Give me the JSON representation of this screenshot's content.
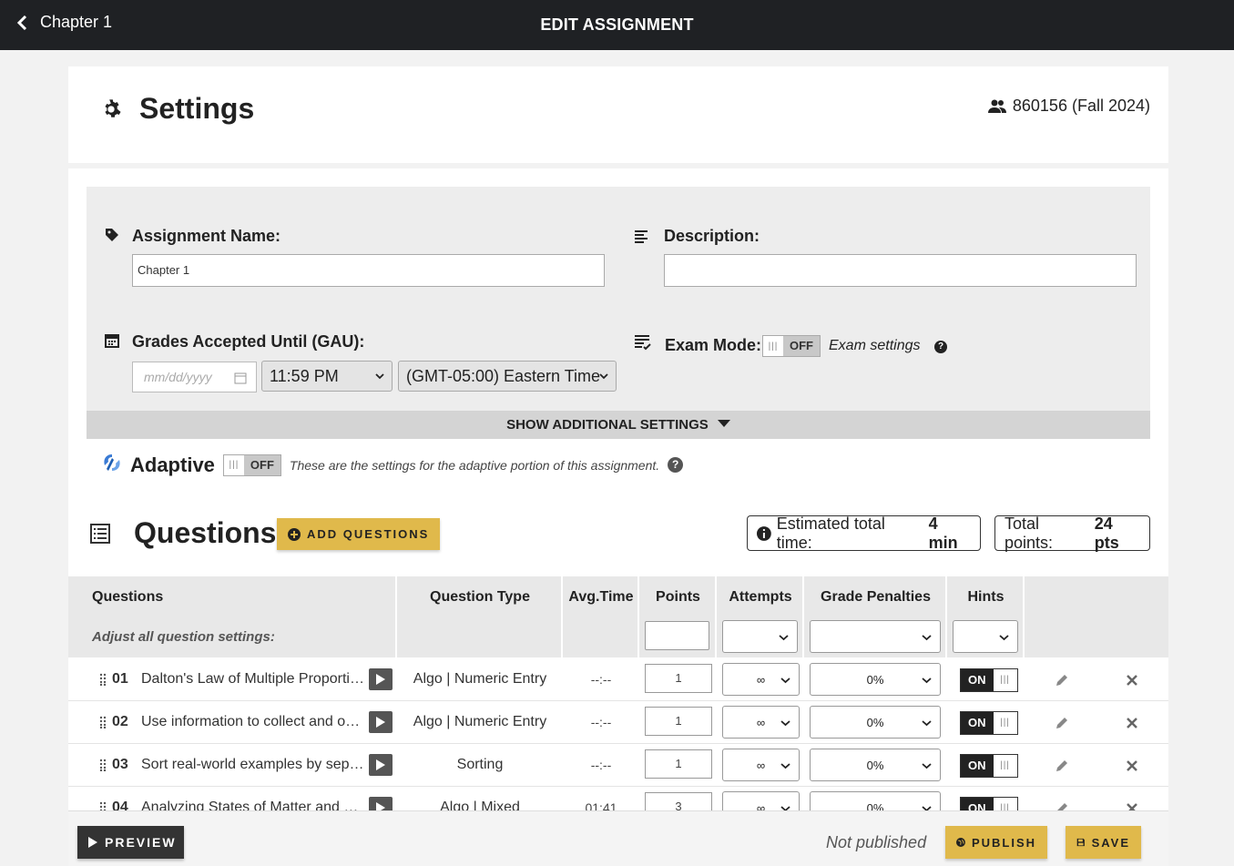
{
  "topbar": {
    "back_label": "Chapter 1",
    "title": "EDIT ASSIGNMENT"
  },
  "header": {
    "title": "Settings",
    "course": "860156 (Fall 2024)"
  },
  "form": {
    "assignment_name_label": "Assignment Name:",
    "assignment_name_value": "Chapter 1",
    "description_label": "Description:",
    "description_value": "",
    "gau_label": "Grades Accepted Until (GAU):",
    "date_placeholder": "mm/dd/yyyy",
    "time_value": "11:59 PM",
    "timezone_value": "(GMT-05:00) Eastern Time",
    "exam_mode_label": "Exam Mode:",
    "exam_mode_state": "OFF",
    "exam_settings_link": "Exam settings",
    "show_additional": "SHOW ADDITIONAL SETTINGS"
  },
  "adaptive": {
    "label": "Adaptive",
    "state": "OFF",
    "description": "These are the settings for the adaptive portion of this assignment."
  },
  "questions": {
    "title": "Questions",
    "add_button": "ADD QUESTIONS",
    "estimated_label": "Estimated total time:",
    "estimated_value": "4 min",
    "total_points_label": "Total points:",
    "total_points_value": "24 pts",
    "columns": {
      "questions": "Questions",
      "type": "Question Type",
      "avg_time": "Avg.Time",
      "points": "Points",
      "attempts": "Attempts",
      "penalties": "Grade Penalties",
      "hints": "Hints"
    },
    "adjust_all_label": "Adjust all question settings:",
    "rows": [
      {
        "num": "01",
        "title": "Dalton's Law of Multiple Proportions",
        "type": "Algo | Numeric Entry",
        "avg": "--:--",
        "points": "1",
        "attempts": "∞",
        "penalty": "0%",
        "hints": "ON"
      },
      {
        "num": "02",
        "title": "Use information to collect and organize data",
        "type": "Algo | Numeric Entry",
        "avg": "--:--",
        "points": "1",
        "attempts": "∞",
        "penalty": "0%",
        "hints": "ON"
      },
      {
        "num": "03",
        "title": "Sort real-world examples by separation technique",
        "type": "Sorting",
        "avg": "--:--",
        "points": "1",
        "attempts": "∞",
        "penalty": "0%",
        "hints": "ON"
      },
      {
        "num": "04",
        "title": "Analyzing States of Matter and Properties",
        "type": "Algo | Mixed",
        "avg": "01:41",
        "points": "3",
        "attempts": "∞",
        "penalty": "0%",
        "hints": "ON"
      }
    ]
  },
  "footer": {
    "preview": "PREVIEW",
    "status": "Not published",
    "publish": "PUBLISH",
    "save": "SAVE"
  },
  "colors": {
    "topbar": "#1f2124",
    "accent_gold": "#e0b94b",
    "adaptive_blue": "#3a7bd5"
  }
}
